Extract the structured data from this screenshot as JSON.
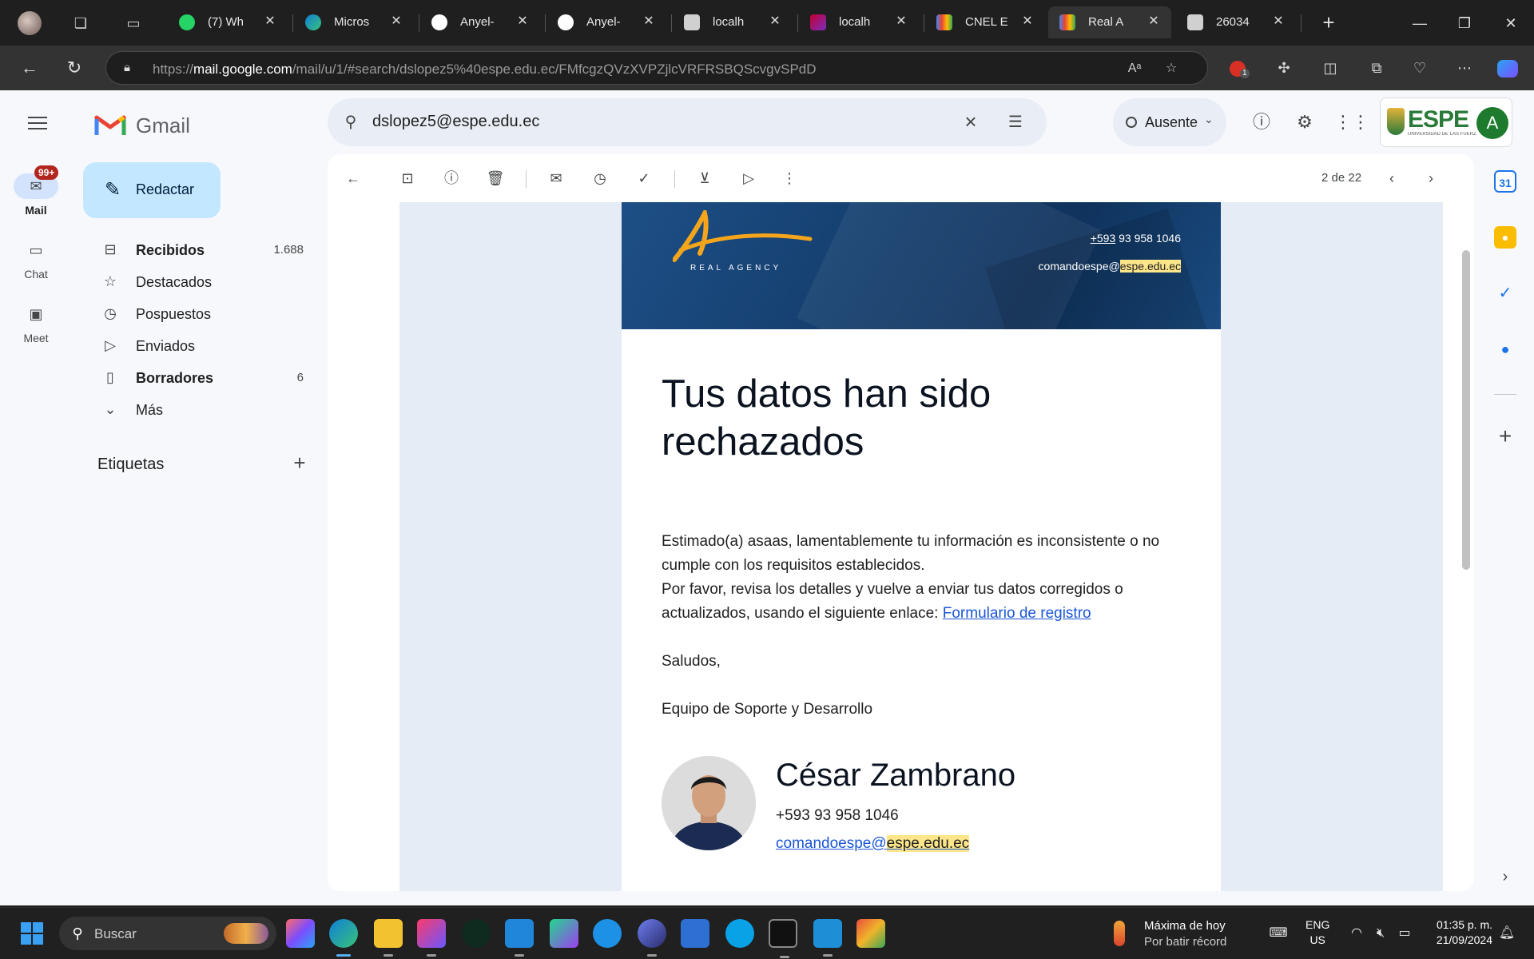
{
  "browser": {
    "tabs": [
      {
        "title": "(7) Wh",
        "icon": "whatsapp-icon",
        "color": "#25d366"
      },
      {
        "title": "Micros",
        "icon": "edge-icon",
        "color": "#0f7fd6"
      },
      {
        "title": "Anyel-",
        "icon": "github-icon",
        "color": "#ffffff"
      },
      {
        "title": "Anyel-",
        "icon": "github-icon",
        "color": "#ffffff"
      },
      {
        "title": "localh",
        "icon": "page-icon",
        "color": "#d0d0d0"
      },
      {
        "title": "localh",
        "icon": "angular-icon",
        "color": "#c3002f"
      },
      {
        "title": "CNEL E",
        "icon": "gmail-icon",
        "color": "#ea4335"
      },
      {
        "title": "Real A",
        "icon": "gmail-icon",
        "color": "#ea4335",
        "active": true
      },
      {
        "title": "26034",
        "icon": "document-icon",
        "color": "#d0d0d0"
      }
    ],
    "url_prefix": "https://",
    "url_host": "mail.google.com",
    "url_path": "/mail/u/1/#search/dslopez5%40espe.edu.ec/FMfcgzQVzXVPZjlcVRFRSBQScvgvSPdD",
    "notification_count": "1"
  },
  "gmail": {
    "brand": "Gmail",
    "search_query": "dslopez5@espe.edu.ec",
    "status": "Ausente",
    "account_initial": "A",
    "org_logo": "ESPE",
    "org_subtitle": "UNIVERSIDAD DE LAS FUERZAS ARMADAS",
    "rail": {
      "mail_label": "Mail",
      "mail_badge": "99+",
      "chat_label": "Chat",
      "meet_label": "Meet"
    },
    "compose_label": "Redactar",
    "nav": [
      {
        "label": "Recibidos",
        "count": "1.688",
        "bold": true,
        "icon": "inbox-icon"
      },
      {
        "label": "Destacados",
        "count": "",
        "bold": false,
        "icon": "star-icon"
      },
      {
        "label": "Pospuestos",
        "count": "",
        "bold": false,
        "icon": "clock-icon"
      },
      {
        "label": "Enviados",
        "count": "",
        "bold": false,
        "icon": "send-icon"
      },
      {
        "label": "Borradores",
        "count": "6",
        "bold": true,
        "icon": "draft-icon"
      },
      {
        "label": "Más",
        "count": "",
        "bold": false,
        "icon": "chevron-down-icon"
      }
    ],
    "labels_header": "Etiquetas",
    "pager": "2 de 22"
  },
  "email": {
    "banner": {
      "agency": "REAL AGENCY",
      "phone_prefix": "+593",
      "phone_rest": " 93 958 1046",
      "mail_user": "comandoespe@",
      "mail_domain": "espe.edu.ec"
    },
    "headline": "Tus datos han sido rechazados",
    "para1": "Estimado(a) asaas, lamentablemente tu información es inconsistente o no cumple con los requisitos establecidos.",
    "para2_text": "Por favor, revisa los detalles y vuelve a enviar tus datos corregidos o actualizados, usando el siguiente enlace: ",
    "para2_link": "Formulario de registro",
    "greeting": "Saludos,",
    "team": "Equipo de Soporte y Desarrollo",
    "signature": {
      "name": "César Zambrano",
      "phone": "+593 93 958 1046",
      "mail_user": "comandoespe@",
      "mail_domain": "espe.edu.ec"
    }
  },
  "taskbar": {
    "search_label": "Buscar",
    "weather_line1": "Máxima de hoy",
    "weather_line2": "Por batir récord",
    "lang_line1": "ENG",
    "lang_line2": "US",
    "time": "01:35 p. m.",
    "date": "21/09/2024"
  },
  "colors": {
    "accent": "#0b57d0",
    "compose_bg": "#c2e7ff",
    "highlight": "#fde68a",
    "banner": "#153f6f",
    "badge": "#b3261e"
  }
}
